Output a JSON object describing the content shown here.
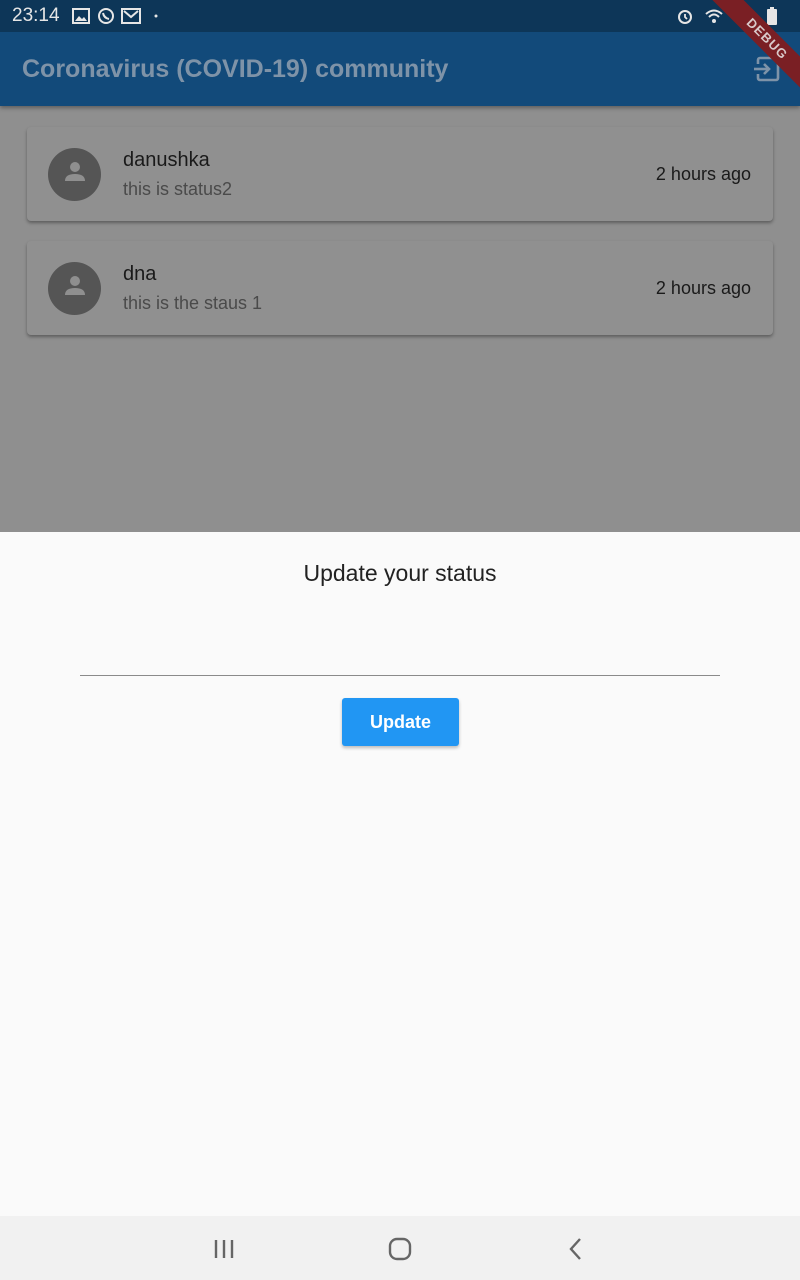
{
  "status_bar": {
    "time": "23:14",
    "icons": [
      "image-icon",
      "whatsapp-icon",
      "gmail-icon",
      "dot-icon",
      "alarm-icon",
      "wifi-icon",
      "signal-icon",
      "battery-icon"
    ]
  },
  "app_bar": {
    "title": "Coronavirus (COVID-19) community",
    "action_icon": "exit-icon",
    "debug_banner": "DEBUG"
  },
  "feed": {
    "items": [
      {
        "name": "danushka",
        "status": "this is status2",
        "time": "2 hours ago",
        "avatar_icon": "person-icon"
      },
      {
        "name": "dna",
        "status": "this is the staus 1",
        "time": "2 hours ago",
        "avatar_icon": "person-icon"
      }
    ]
  },
  "sheet": {
    "title": "Update your status",
    "input_value": "",
    "update_label": "Update"
  },
  "nav_bar": {
    "icons": [
      "recent-apps-icon",
      "home-icon",
      "back-icon"
    ]
  },
  "colors": {
    "app_bar": "#124a7a",
    "status_bar": "#0d3658",
    "scrim": "#8f8f8f",
    "button": "#2196f3",
    "debug_banner": "#7a1f24"
  }
}
